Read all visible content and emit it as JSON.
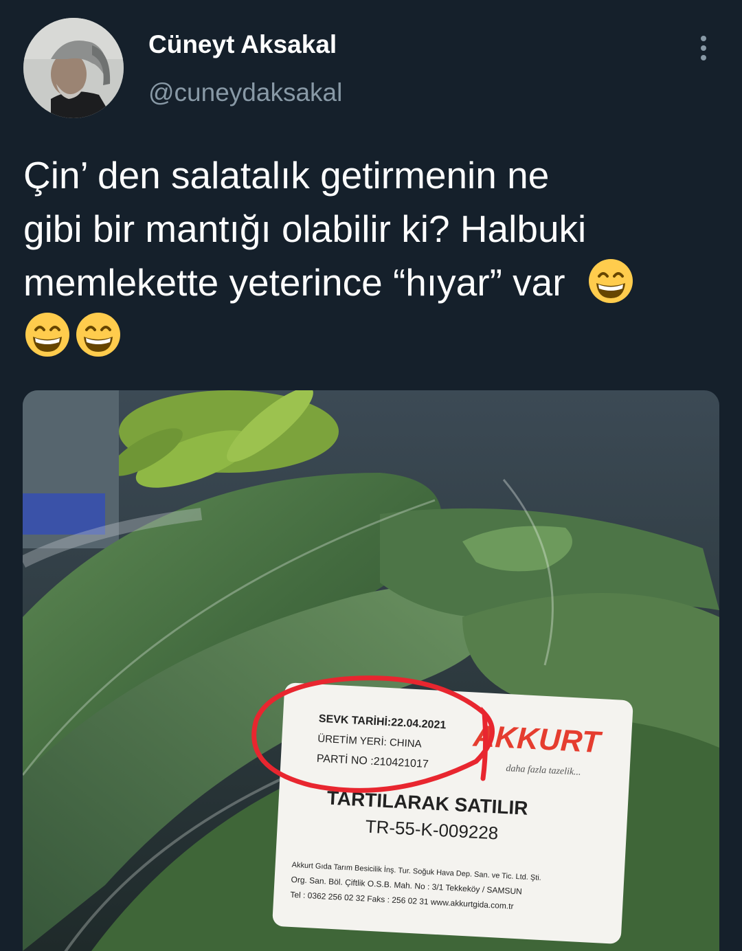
{
  "author": {
    "name": "Cüneyt Aksakal",
    "handle": "@cuneydaksakal"
  },
  "tweet": {
    "lines": [
      "Çin’ den salatalık getirmenin ne",
      "gibi bir mantığı olabilir ki? Halbuki",
      "memlekette yeterince “hıyar”  var"
    ],
    "emoji": "grinning-face-with-smiling-eyes"
  },
  "photo_label": {
    "shipment_date": "SEVK TARİHİ:22.04.2021",
    "origin": "ÜRETİM YERİ: CHINA",
    "batch": "PARTİ NO :210421017",
    "brand": "AKKURT",
    "slogan": "daha fazla tazelik...",
    "sold_by_weight": "TARTILARAK SATILIR",
    "code": "TR-55-K-009228",
    "company_line1": "Akkurt Gıda Tarım Besicilik İnş. Tur. Soğuk Hava Dep. San. ve Tic. Ltd. Şti.",
    "company_line2": "Org. San. Böl. Çiftlik O.S.B. Mah. No : 3/1  Tekkeköy / SAMSUN",
    "company_line3": "Tel : 0362 256 02 32  Faks : 256 02 31  www.akkurtgida.com.tr"
  }
}
